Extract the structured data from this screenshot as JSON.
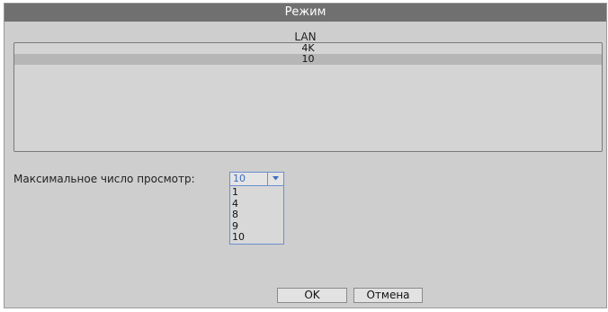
{
  "dialog": {
    "title": "Режим"
  },
  "mode_list": {
    "label": "LAN",
    "items": [
      "4K",
      "10"
    ],
    "selected": "10"
  },
  "max_views": {
    "label": "Максимальное число просмотр:",
    "value": "10",
    "options": [
      "1",
      "4",
      "8",
      "9",
      "10"
    ]
  },
  "buttons": {
    "ok": "OK",
    "cancel": "Отмена"
  },
  "icons": {
    "dropdown": "chevron-down-icon"
  },
  "colors": {
    "title_bar": "#707070",
    "dialog_bg": "#cecece",
    "accent": "#6a8fd0"
  }
}
